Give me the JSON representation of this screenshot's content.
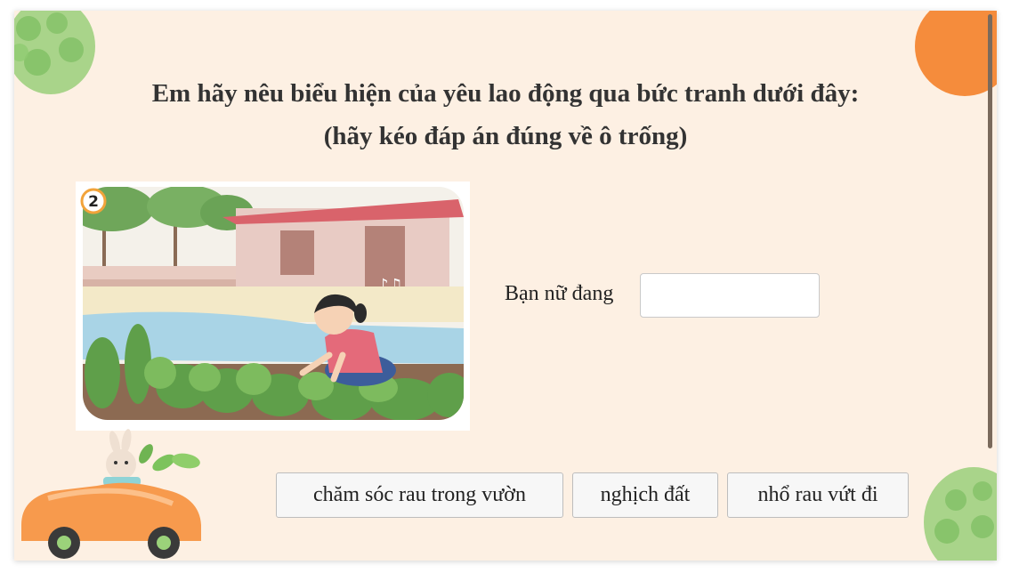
{
  "question": {
    "line1": "Em hãy nêu biểu hiện của yêu lao động qua bức tranh dưới đây:",
    "line2": "(hãy kéo đáp án đúng về ô trống)"
  },
  "illustration": {
    "badge_number": "2"
  },
  "sentence": {
    "prefix": "Bạn nữ đang",
    "answer_value": ""
  },
  "options": [
    {
      "label": "chăm sóc rau trong vườn"
    },
    {
      "label": "nghịch đất"
    },
    {
      "label": "nhổ rau vứt đi"
    }
  ],
  "colors": {
    "background": "#fdf0e3",
    "accent_orange": "#f58c3c",
    "accent_green": "#8cc86e"
  },
  "icons": [
    "leaf-egg-decoration",
    "orange-circle-decoration",
    "bunny-car-decoration"
  ]
}
